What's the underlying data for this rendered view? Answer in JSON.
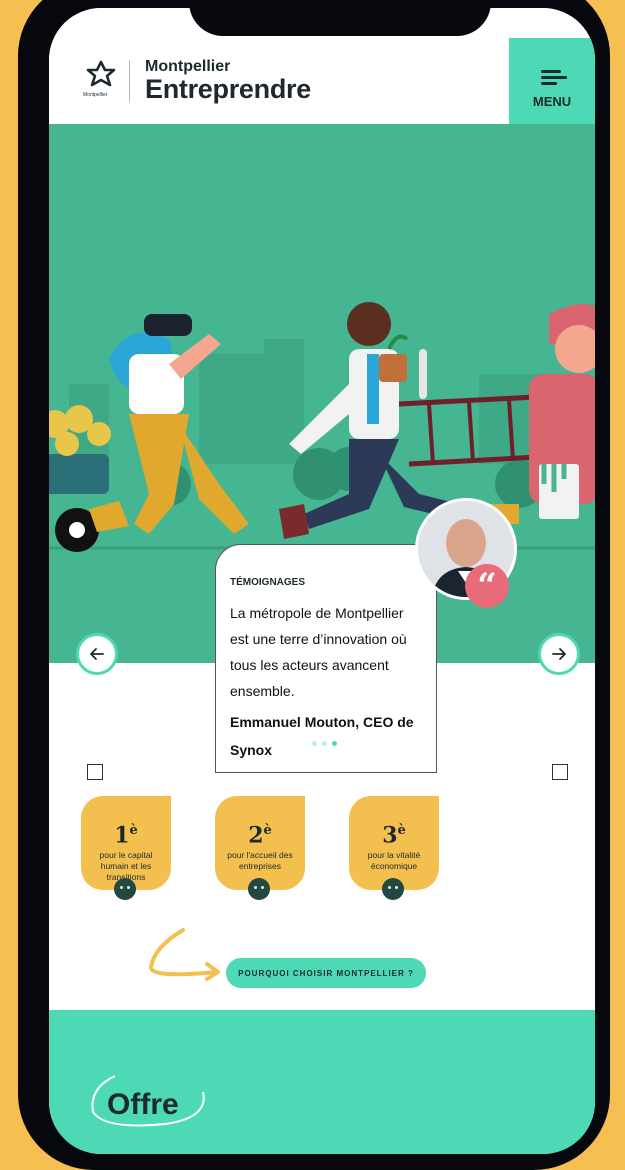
{
  "header": {
    "logo_small_text": "Montpellier",
    "brand_top": "Montpellier",
    "brand_bottom": "Entreprendre",
    "menu_label": "MENU"
  },
  "testimonial": {
    "kicker": "TÉMOIGNAGES",
    "quote": "La métropole de Montpellier est une terre d’innovation où tous les acteurs avancent ensemble.",
    "author": "Emmanuel Mouton, CEO de Synox",
    "quote_glyph": "“",
    "pagination": {
      "total": 3,
      "active": 3
    }
  },
  "stats": [
    {
      "rank": "1",
      "suffix": "è",
      "text": "pour le capital humain et les transitions"
    },
    {
      "rank": "2",
      "suffix": "è",
      "text": "pour l'accueil des entreprises"
    },
    {
      "rank": "3",
      "suffix": "è",
      "text": "pour la vitalité économique"
    }
  ],
  "cta": {
    "label": "POURQUOI CHOISIR MONTPELLIER ?"
  },
  "footer": {
    "title": "Offre"
  },
  "colors": {
    "accent": "#4ED9B6",
    "hero": "#45B592",
    "yellow": "#F3BF4F",
    "pink": "#E96B7A",
    "dark": "#1c2a30"
  }
}
